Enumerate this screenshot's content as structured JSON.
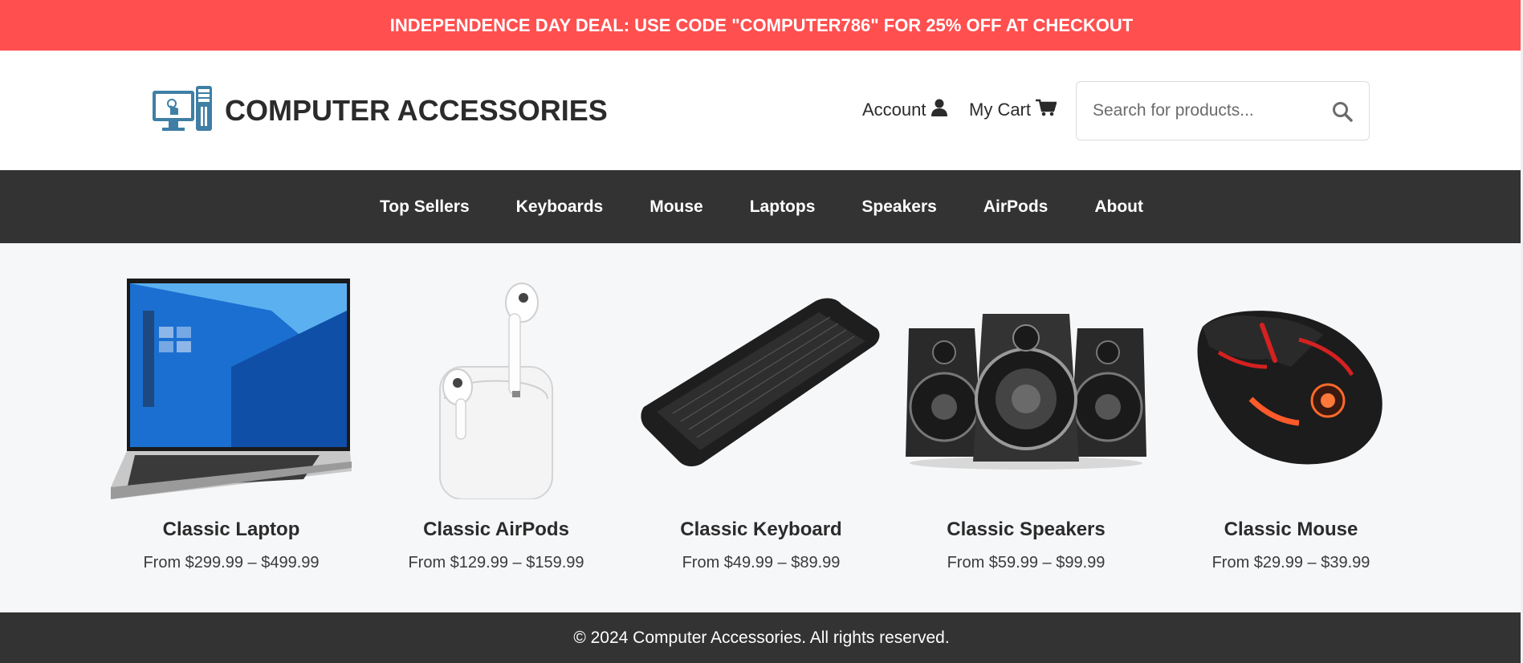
{
  "promo": {
    "text": "INDEPENDENCE DAY DEAL: USE CODE \"COMPUTER786\" FOR 25% OFF AT CHECKOUT",
    "bg": "#ff4f4f"
  },
  "header": {
    "logo_text": "COMPUTER ACCESSORIES",
    "logo_icon": "computer-icon",
    "account_label": "Account",
    "account_icon": "user-icon",
    "cart_label": "My Cart",
    "cart_icon": "cart-icon",
    "search": {
      "placeholder": "Search for products...",
      "icon": "search-icon"
    }
  },
  "nav": {
    "items": [
      {
        "label": "Top Sellers"
      },
      {
        "label": "Keyboards"
      },
      {
        "label": "Mouse"
      },
      {
        "label": "Laptops"
      },
      {
        "label": "Speakers"
      },
      {
        "label": "AirPods"
      },
      {
        "label": "About"
      }
    ]
  },
  "products": [
    {
      "name": "Classic Laptop",
      "price": "From $299.99 – $499.99",
      "image": "laptop-image"
    },
    {
      "name": "Classic AirPods",
      "price": "From $129.99 – $159.99",
      "image": "airpods-image"
    },
    {
      "name": "Classic Keyboard",
      "price": "From $49.99 – $89.99",
      "image": "keyboard-image"
    },
    {
      "name": "Classic Speakers",
      "price": "From $59.99 – $99.99",
      "image": "speakers-image"
    },
    {
      "name": "Classic Mouse",
      "price": "From $29.99 – $39.99",
      "image": "mouse-image"
    }
  ],
  "footer": {
    "text": "© 2024 Computer Accessories. All rights reserved."
  },
  "colors": {
    "accent": "#ff4f4f",
    "dark": "#333333",
    "content_bg": "#f6f7f9"
  }
}
